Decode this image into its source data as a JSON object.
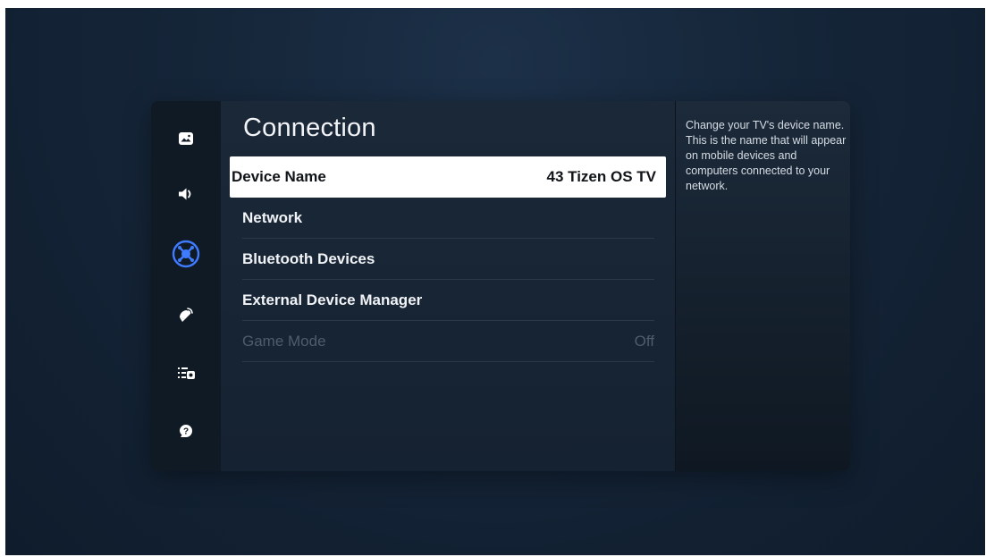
{
  "title": "Connection",
  "menu": [
    {
      "label": "Device Name",
      "value": "43 Tizen OS TV",
      "state": "focused"
    },
    {
      "label": "Network",
      "value": "",
      "state": "normal"
    },
    {
      "label": "Bluetooth Devices",
      "value": "",
      "state": "normal"
    },
    {
      "label": "External Device Manager",
      "value": "",
      "state": "normal"
    },
    {
      "label": "Game Mode",
      "value": "Off",
      "state": "disabled"
    }
  ],
  "help": {
    "text": "Change your TV's device name. This is the name that will appear on mobile devices and computers connected to your network."
  },
  "sidebar": {
    "icons": [
      "picture-icon",
      "sound-icon",
      "connection-icon",
      "broadcasting-icon",
      "general-icon",
      "support-icon"
    ],
    "selected": "connection-icon"
  },
  "colors": {
    "accent": "#3e7bff",
    "focus_bg": "#ffffff",
    "panel_bg": "#15212f"
  }
}
